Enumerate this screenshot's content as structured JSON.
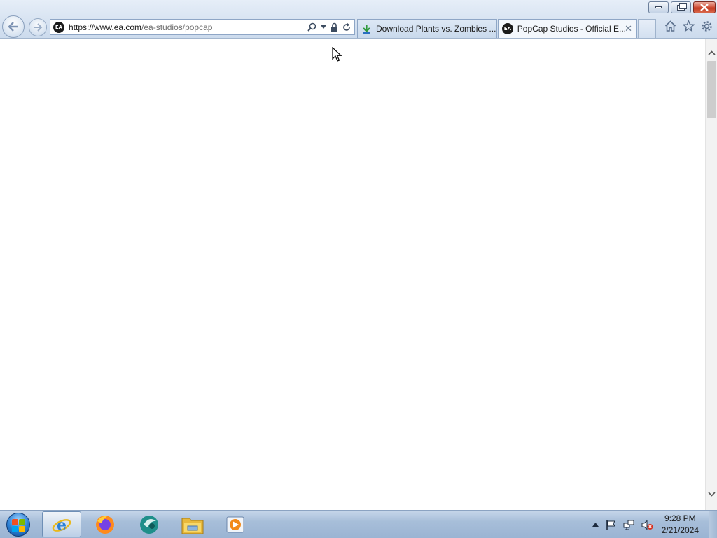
{
  "window": {
    "minimize_label": "",
    "restore_label": "",
    "close_label": ""
  },
  "address_bar": {
    "site_icon": "EA",
    "url_host": "https://www.ea.com",
    "url_path": "/ea-studios/popcap"
  },
  "tabs": [
    {
      "label": "Download Plants vs. Zombies ...",
      "icon": "download-arrow-icon",
      "active": false
    },
    {
      "label": "PopCap Studios - Official E...",
      "icon": "ea-logo-icon",
      "active": true,
      "close": "✕"
    }
  ],
  "toolbar_icons": [
    "home-icon",
    "favorites-star-icon",
    "settings-gear-icon"
  ],
  "taskbar": {
    "apps": [
      "internet-explorer-icon",
      "firefox-icon",
      "media-app-icon",
      "file-explorer-icon",
      "media-player-icon"
    ],
    "time": "9:28 PM",
    "date": "2/21/2024"
  },
  "colors": {
    "chrome_bg": "#d6e2f1",
    "taskbar_bg": "#a7bed9",
    "close_red": "#c33b22"
  }
}
